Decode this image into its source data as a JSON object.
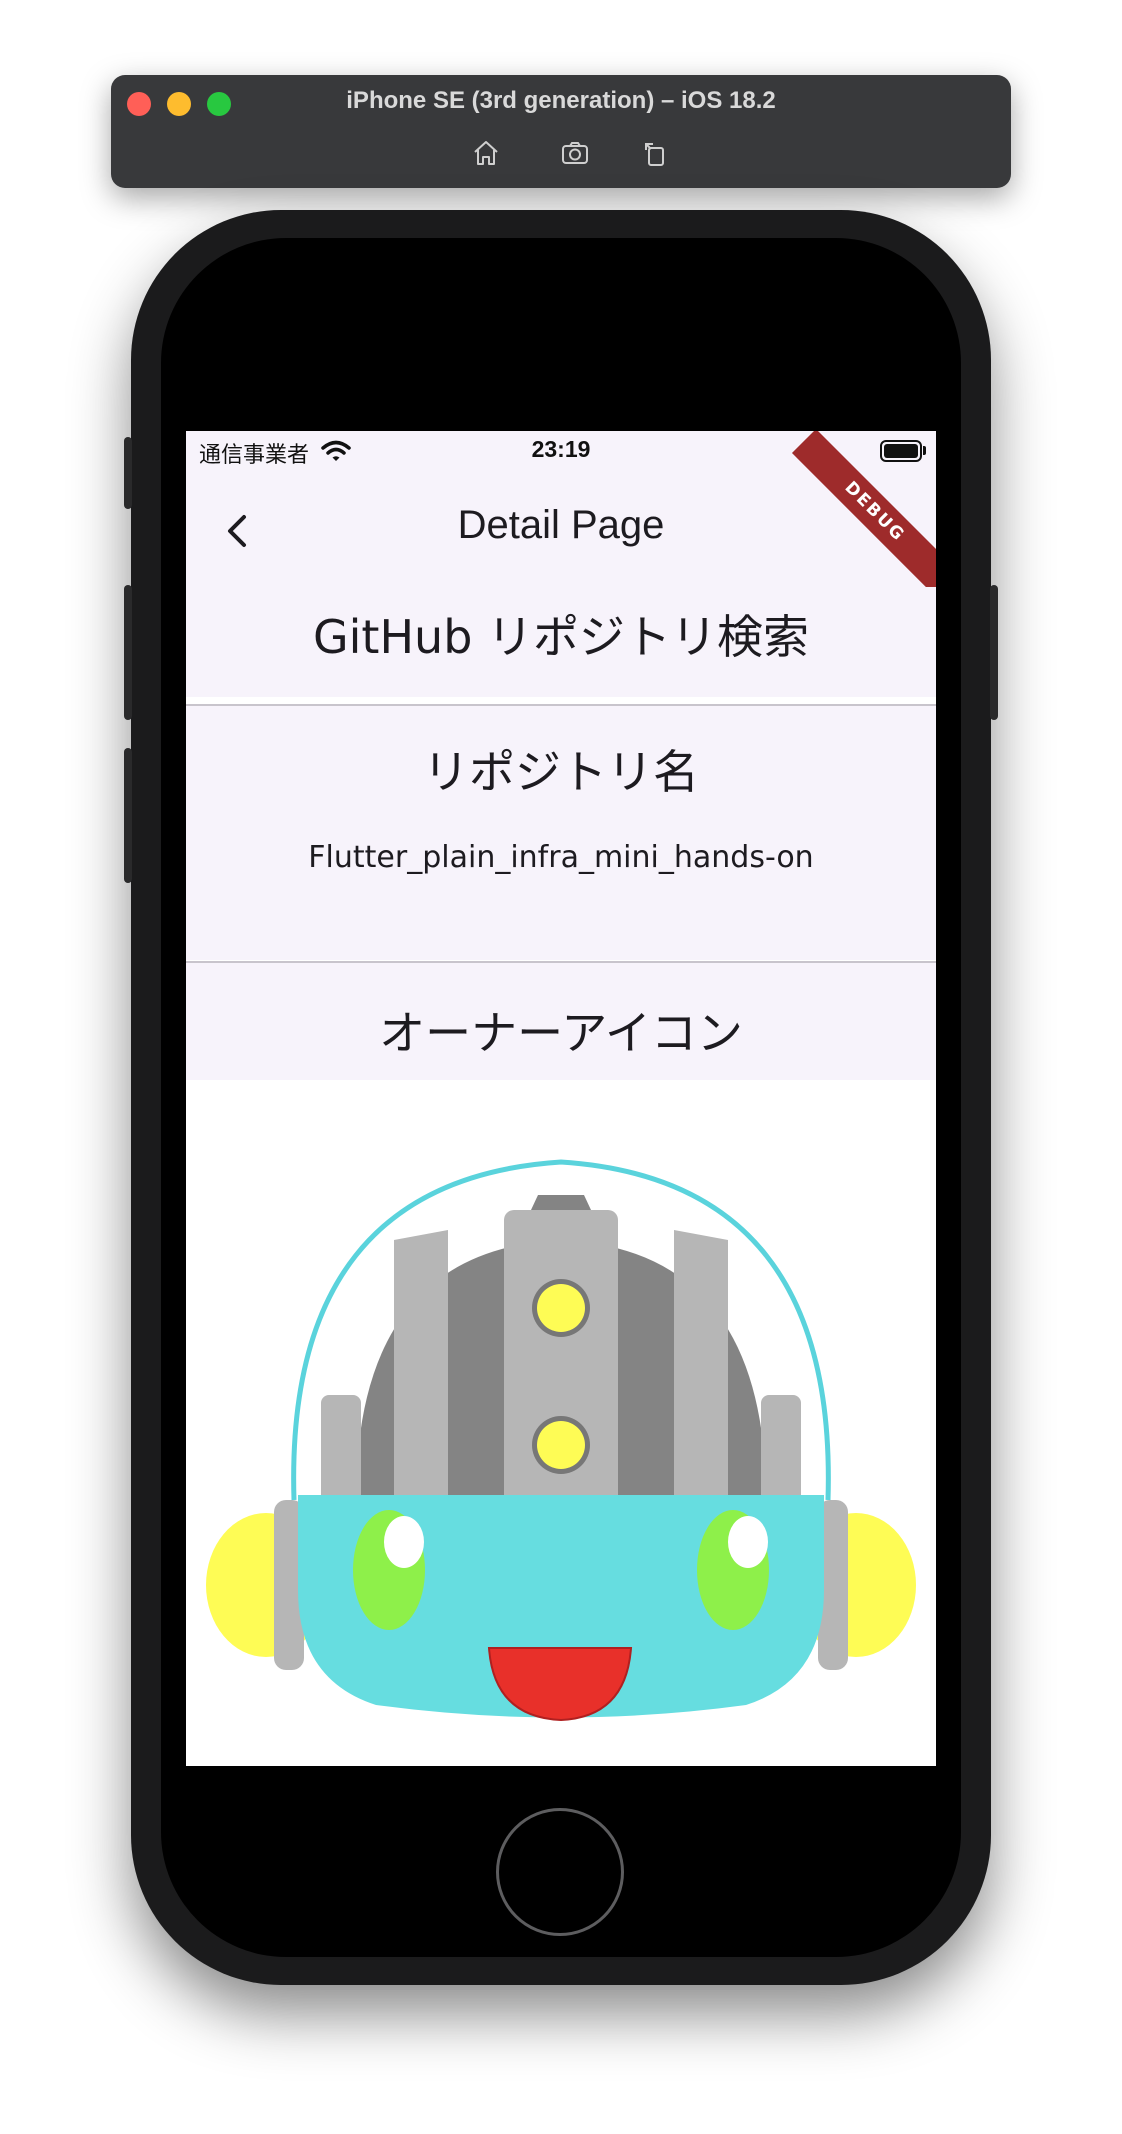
{
  "simulator": {
    "title": "iPhone SE (3rd generation) – iOS 18.2",
    "tools": [
      "home-icon",
      "screenshot-icon",
      "rotate-icon"
    ]
  },
  "status_bar": {
    "carrier": "通信事業者",
    "time": "23:19"
  },
  "debug_banner": "DEBUG",
  "app_bar": {
    "title": "Detail Page"
  },
  "content": {
    "app_heading": "GitHub リポジトリ検索",
    "repo_name_label": "リポジトリ名",
    "repo_name": "Flutter_plain_infra_mini_hands-on",
    "owner_icon_label": "オーナーアイコン"
  },
  "colors": {
    "surface": "#f7f3fb",
    "debug_banner": "#9e2b2b",
    "avatar_face": "#66dde0",
    "avatar_eye": "#8ef04a",
    "avatar_mouth": "#e8302a",
    "avatar_ear": "#fefc55"
  }
}
